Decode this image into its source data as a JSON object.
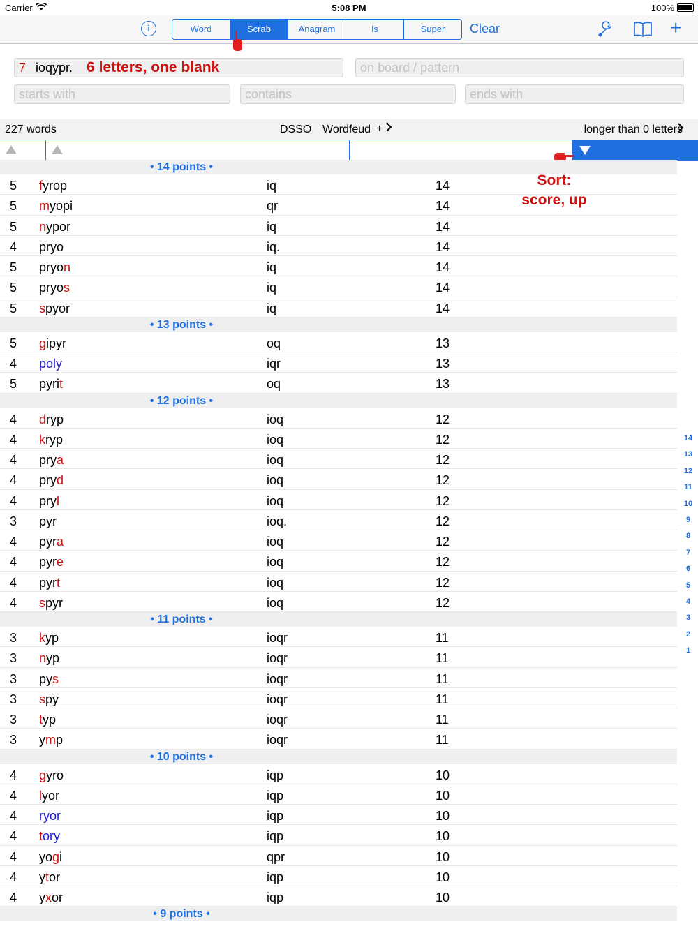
{
  "status": {
    "carrier": "Carrier",
    "time": "5:08 PM",
    "battery": "100%"
  },
  "toolbar": {
    "info_icon": "info-circle-icon",
    "segments": [
      "Word",
      "Scrab",
      "Anagram",
      "Is",
      "Super"
    ],
    "active_segment": "Scrab",
    "clear_label": "Clear",
    "icons": [
      "wrench-icon",
      "book-icon",
      "plus-icon"
    ]
  },
  "inputs": {
    "letter_count": "7",
    "letters_value": "ioqypr.",
    "letters_annotation": "6 letters, one blank",
    "board_placeholder": "on board / pattern",
    "starts_placeholder": "starts with",
    "contains_placeholder": "contains",
    "ends_placeholder": "ends with"
  },
  "infobar": {
    "word_count": "227 words",
    "dictionary": "DSSO",
    "game": "Wordfeud",
    "plus": "+",
    "filter": "longer than 0 letters"
  },
  "sort_annotation": [
    "Sort:",
    "score, up"
  ],
  "sections": [
    {
      "label": "• 14 points •",
      "rows": [
        {
          "len": "5",
          "word": [
            [
              "f",
              "r"
            ],
            [
              "yrop",
              ""
            ]
          ],
          "left": "iq",
          "pts": "14"
        },
        {
          "len": "5",
          "word": [
            [
              "m",
              "r"
            ],
            [
              "yopi",
              ""
            ]
          ],
          "left": "qr",
          "pts": "14"
        },
        {
          "len": "5",
          "word": [
            [
              "n",
              "r"
            ],
            [
              "ypor",
              ""
            ]
          ],
          "left": "iq",
          "pts": "14"
        },
        {
          "len": "4",
          "word": [
            [
              "pryo",
              ""
            ]
          ],
          "left": "iq.",
          "pts": "14"
        },
        {
          "len": "5",
          "word": [
            [
              "pryo",
              ""
            ],
            [
              "n",
              "r"
            ]
          ],
          "left": "iq",
          "pts": "14"
        },
        {
          "len": "5",
          "word": [
            [
              "pryo",
              ""
            ],
            [
              "s",
              "r"
            ]
          ],
          "left": "iq",
          "pts": "14"
        },
        {
          "len": "5",
          "word": [
            [
              "s",
              "r"
            ],
            [
              "pyor",
              ""
            ]
          ],
          "left": "iq",
          "pts": "14"
        }
      ]
    },
    {
      "label": "• 13 points •",
      "rows": [
        {
          "len": "5",
          "word": [
            [
              "g",
              "r"
            ],
            [
              "ipyr",
              ""
            ]
          ],
          "left": "oq",
          "pts": "13"
        },
        {
          "len": "4",
          "word": [
            [
              "po",
              "b"
            ],
            [
              "ly",
              "b"
            ]
          ],
          "left": "iqr",
          "pts": "13"
        },
        {
          "len": "5",
          "word": [
            [
              "pyri",
              ""
            ],
            [
              "t",
              "r"
            ]
          ],
          "left": "oq",
          "pts": "13"
        }
      ]
    },
    {
      "label": "• 12 points •",
      "rows": [
        {
          "len": "4",
          "word": [
            [
              "d",
              "r"
            ],
            [
              "ryp",
              ""
            ]
          ],
          "left": "ioq",
          "pts": "12"
        },
        {
          "len": "4",
          "word": [
            [
              "k",
              "r"
            ],
            [
              "ryp",
              ""
            ]
          ],
          "left": "ioq",
          "pts": "12"
        },
        {
          "len": "4",
          "word": [
            [
              "pry",
              ""
            ],
            [
              "a",
              "r"
            ]
          ],
          "left": "ioq",
          "pts": "12"
        },
        {
          "len": "4",
          "word": [
            [
              "pry",
              ""
            ],
            [
              "d",
              "r"
            ]
          ],
          "left": "ioq",
          "pts": "12"
        },
        {
          "len": "4",
          "word": [
            [
              "pry",
              ""
            ],
            [
              "l",
              "r"
            ]
          ],
          "left": "ioq",
          "pts": "12"
        },
        {
          "len": "3",
          "word": [
            [
              "pyr",
              ""
            ]
          ],
          "left": "ioq.",
          "pts": "12"
        },
        {
          "len": "4",
          "word": [
            [
              "pyr",
              ""
            ],
            [
              "a",
              "r"
            ]
          ],
          "left": "ioq",
          "pts": "12"
        },
        {
          "len": "4",
          "word": [
            [
              "pyr",
              ""
            ],
            [
              "e",
              "r"
            ]
          ],
          "left": "ioq",
          "pts": "12"
        },
        {
          "len": "4",
          "word": [
            [
              "pyr",
              ""
            ],
            [
              "t",
              "r"
            ]
          ],
          "left": "ioq",
          "pts": "12"
        },
        {
          "len": "4",
          "word": [
            [
              "s",
              "r"
            ],
            [
              "pyr",
              ""
            ]
          ],
          "left": "ioq",
          "pts": "12"
        }
      ]
    },
    {
      "label": "• 11 points •",
      "rows": [
        {
          "len": "3",
          "word": [
            [
              "k",
              "r"
            ],
            [
              "yp",
              ""
            ]
          ],
          "left": "ioqr",
          "pts": "11"
        },
        {
          "len": "3",
          "word": [
            [
              "n",
              "r"
            ],
            [
              "yp",
              ""
            ]
          ],
          "left": "ioqr",
          "pts": "11"
        },
        {
          "len": "3",
          "word": [
            [
              "py",
              ""
            ],
            [
              "s",
              "r"
            ]
          ],
          "left": "ioqr",
          "pts": "11"
        },
        {
          "len": "3",
          "word": [
            [
              "s",
              "r"
            ],
            [
              "py",
              ""
            ]
          ],
          "left": "ioqr",
          "pts": "11"
        },
        {
          "len": "3",
          "word": [
            [
              "t",
              "r"
            ],
            [
              "yp",
              ""
            ]
          ],
          "left": "ioqr",
          "pts": "11"
        },
        {
          "len": "3",
          "word": [
            [
              "y",
              ""
            ],
            [
              "m",
              "r"
            ],
            [
              "p",
              ""
            ]
          ],
          "left": "ioqr",
          "pts": "11"
        }
      ]
    },
    {
      "label": "• 10 points •",
      "rows": [
        {
          "len": "4",
          "word": [
            [
              "g",
              "r"
            ],
            [
              "yro",
              ""
            ]
          ],
          "left": "iqp",
          "pts": "10"
        },
        {
          "len": "4",
          "word": [
            [
              "l",
              "r"
            ],
            [
              "yor",
              ""
            ]
          ],
          "left": "iqp",
          "pts": "10"
        },
        {
          "len": "4",
          "word": [
            [
              "r",
              "b"
            ],
            [
              "yor",
              "b"
            ]
          ],
          "left": "iqp",
          "pts": "10"
        },
        {
          "len": "4",
          "word": [
            [
              "t",
              "r"
            ],
            [
              "ory",
              "b"
            ]
          ],
          "left": "iqp",
          "pts": "10"
        },
        {
          "len": "4",
          "word": [
            [
              "yo",
              ""
            ],
            [
              "g",
              "r"
            ],
            [
              "i",
              ""
            ]
          ],
          "left": "qpr",
          "pts": "10"
        },
        {
          "len": "4",
          "word": [
            [
              "y",
              ""
            ],
            [
              "t",
              "r"
            ],
            [
              "or",
              ""
            ]
          ],
          "left": "iqp",
          "pts": "10"
        },
        {
          "len": "4",
          "word": [
            [
              "y",
              ""
            ],
            [
              "x",
              "r"
            ],
            [
              "or",
              ""
            ]
          ],
          "left": "iqp",
          "pts": "10"
        }
      ]
    },
    {
      "label": "• 9 points •",
      "rows": []
    }
  ],
  "index": [
    "14",
    "13",
    "12",
    "11",
    "10",
    "9",
    "8",
    "7",
    "6",
    "5",
    "4",
    "3",
    "2",
    "1"
  ],
  "colors": {
    "accent": "#1e6fe0",
    "annotation_red": "#cc1111",
    "blank_blue": "#1a1ad6"
  }
}
